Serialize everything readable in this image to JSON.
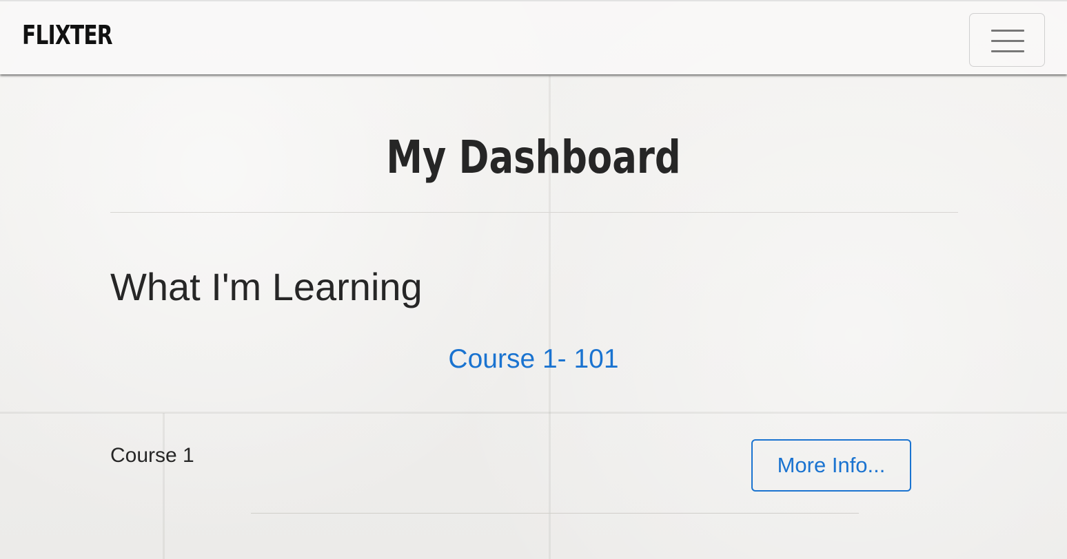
{
  "navbar": {
    "brand": "FLIXTER",
    "menu_toggle": "hamburger-menu"
  },
  "main": {
    "title": "My Dashboard",
    "section_heading": "What I'm Learning",
    "course_link": "Course 1- 101",
    "course_name": "Course 1",
    "more_info_label": "More Info..."
  },
  "colors": {
    "link_blue": "#1a73d0",
    "text_dark": "#262626"
  }
}
